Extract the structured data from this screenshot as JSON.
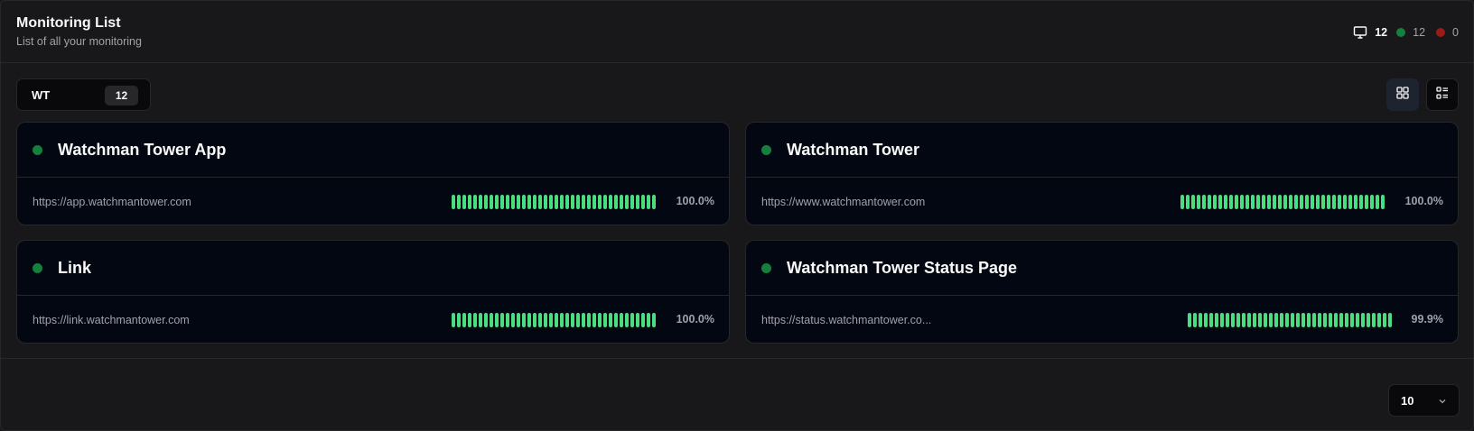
{
  "header": {
    "title": "Monitoring List",
    "subtitle": "List of all your monitoring",
    "stats": {
      "total": "12",
      "up": "12",
      "down": "0"
    }
  },
  "group": {
    "name": "WT",
    "count": "12"
  },
  "view_buttons": {
    "grid_icon": "grid-icon",
    "list_icon": "list-icon"
  },
  "monitors": [
    {
      "name": "Watchman Tower App",
      "url": "https://app.watchmantower.com",
      "uptime": "100.0%",
      "status": "up"
    },
    {
      "name": "Watchman Tower",
      "url": "https://www.watchmantower.com",
      "uptime": "100.0%",
      "status": "up"
    },
    {
      "name": "Link",
      "url": "https://link.watchmantower.com",
      "uptime": "100.0%",
      "status": "up"
    },
    {
      "name": "Watchman Tower Status Page",
      "url": "https://status.watchmantower.co...",
      "uptime": "99.9%",
      "status": "up"
    }
  ],
  "pagination": {
    "page_size": "10"
  },
  "colors": {
    "up": "#15803d",
    "down": "#991b1b",
    "bar": "#4ade80",
    "background": "#18181b",
    "card": "#030712"
  }
}
